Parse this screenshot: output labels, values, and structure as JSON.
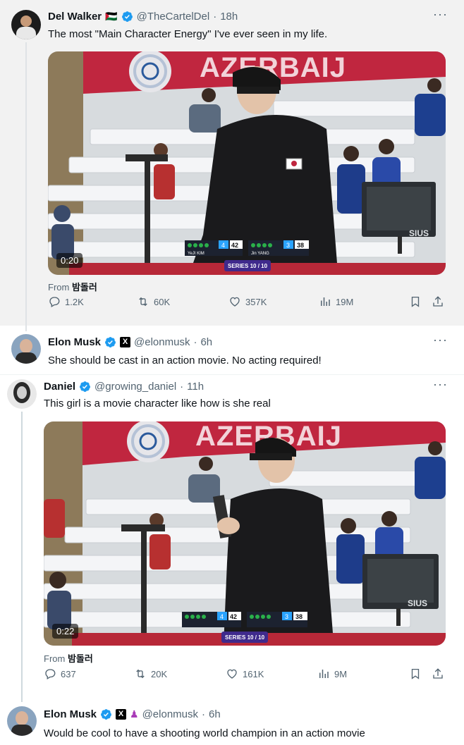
{
  "tweet1": {
    "name": "Del Walker",
    "flag": "🇵🇸",
    "handle": "@TheCartelDel",
    "time": "18h",
    "text": "The most \"Main Character Energy\" I've ever seen in my life.",
    "video": {
      "banner_text": "AZERBAIJ",
      "duration": "0:20",
      "series": "SERIES 10 / 10",
      "score_left_name": "YeJI KIM",
      "score_left_a": "4",
      "score_left_b": "42",
      "score_right_name": "Jin YANG",
      "score_right_a": "3",
      "score_right_b": "38",
      "sius": "SIUS"
    },
    "from_label": "From",
    "from_source": "밤돌러",
    "stats": {
      "replies": "1.2K",
      "reposts": "60K",
      "likes": "357K",
      "views": "19M"
    }
  },
  "tweet2": {
    "name": "Elon Musk",
    "handle": "@elonmusk",
    "time": "6h",
    "text": "She should be cast in an action movie. No  acting required!"
  },
  "tweet3": {
    "name": "Daniel",
    "handle": "@growing_daniel",
    "time": "11h",
    "text": "This girl is a movie character like how is she real",
    "video": {
      "banner_text": "AZERBAIJ",
      "duration": "0:22",
      "series": "SERIES 10 / 10",
      "score_left_a": "4",
      "score_left_b": "42",
      "score_right_a": "3",
      "score_right_b": "38",
      "sius": "SIUS"
    },
    "from_label": "From",
    "from_source": "밤돌러",
    "stats": {
      "replies": "637",
      "reposts": "20K",
      "likes": "161K",
      "views": "9M"
    }
  },
  "tweet4": {
    "name": "Elon Musk",
    "handle": "@elonmusk",
    "time": "6h",
    "text": "Would be cool to have a shooting world champion in an action movie"
  },
  "colors": {
    "verified": "#1d9bf0",
    "meta": "#536471",
    "line": "#cfd9de",
    "banner": "#c0263f"
  }
}
